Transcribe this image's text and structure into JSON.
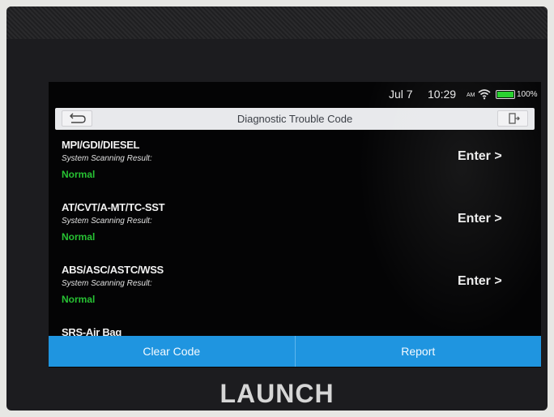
{
  "status_bar": {
    "date": "Jul 7",
    "time": "10:29",
    "ampm": "AM",
    "battery": "100%",
    "wifi_icon": "wifi-icon",
    "battery_icon": "battery-icon"
  },
  "header": {
    "title": "Diagnostic Trouble Code",
    "back_icon": "back-arrow-icon",
    "exit_icon": "exit-door-icon"
  },
  "systems": [
    {
      "name": "MPI/GDI/DIESEL",
      "scan_label": "System Scanning Result:",
      "status": "Normal",
      "action": "Enter >"
    },
    {
      "name": "AT/CVT/A-MT/TC-SST",
      "scan_label": "System Scanning Result:",
      "status": "Normal",
      "action": "Enter >"
    },
    {
      "name": "ABS/ASC/ASTC/WSS",
      "scan_label": "System Scanning Result:",
      "status": "Normal",
      "action": "Enter >"
    }
  ],
  "partial_item": {
    "name": "SRS-Air Bag"
  },
  "footer": {
    "clear_code": "Clear Code",
    "report": "Report"
  },
  "device": {
    "brand": "LAUNCH"
  },
  "colors": {
    "normal_status": "#27c233",
    "button_bar": "#1f95e0",
    "title_bar": "#e8e9ec"
  }
}
